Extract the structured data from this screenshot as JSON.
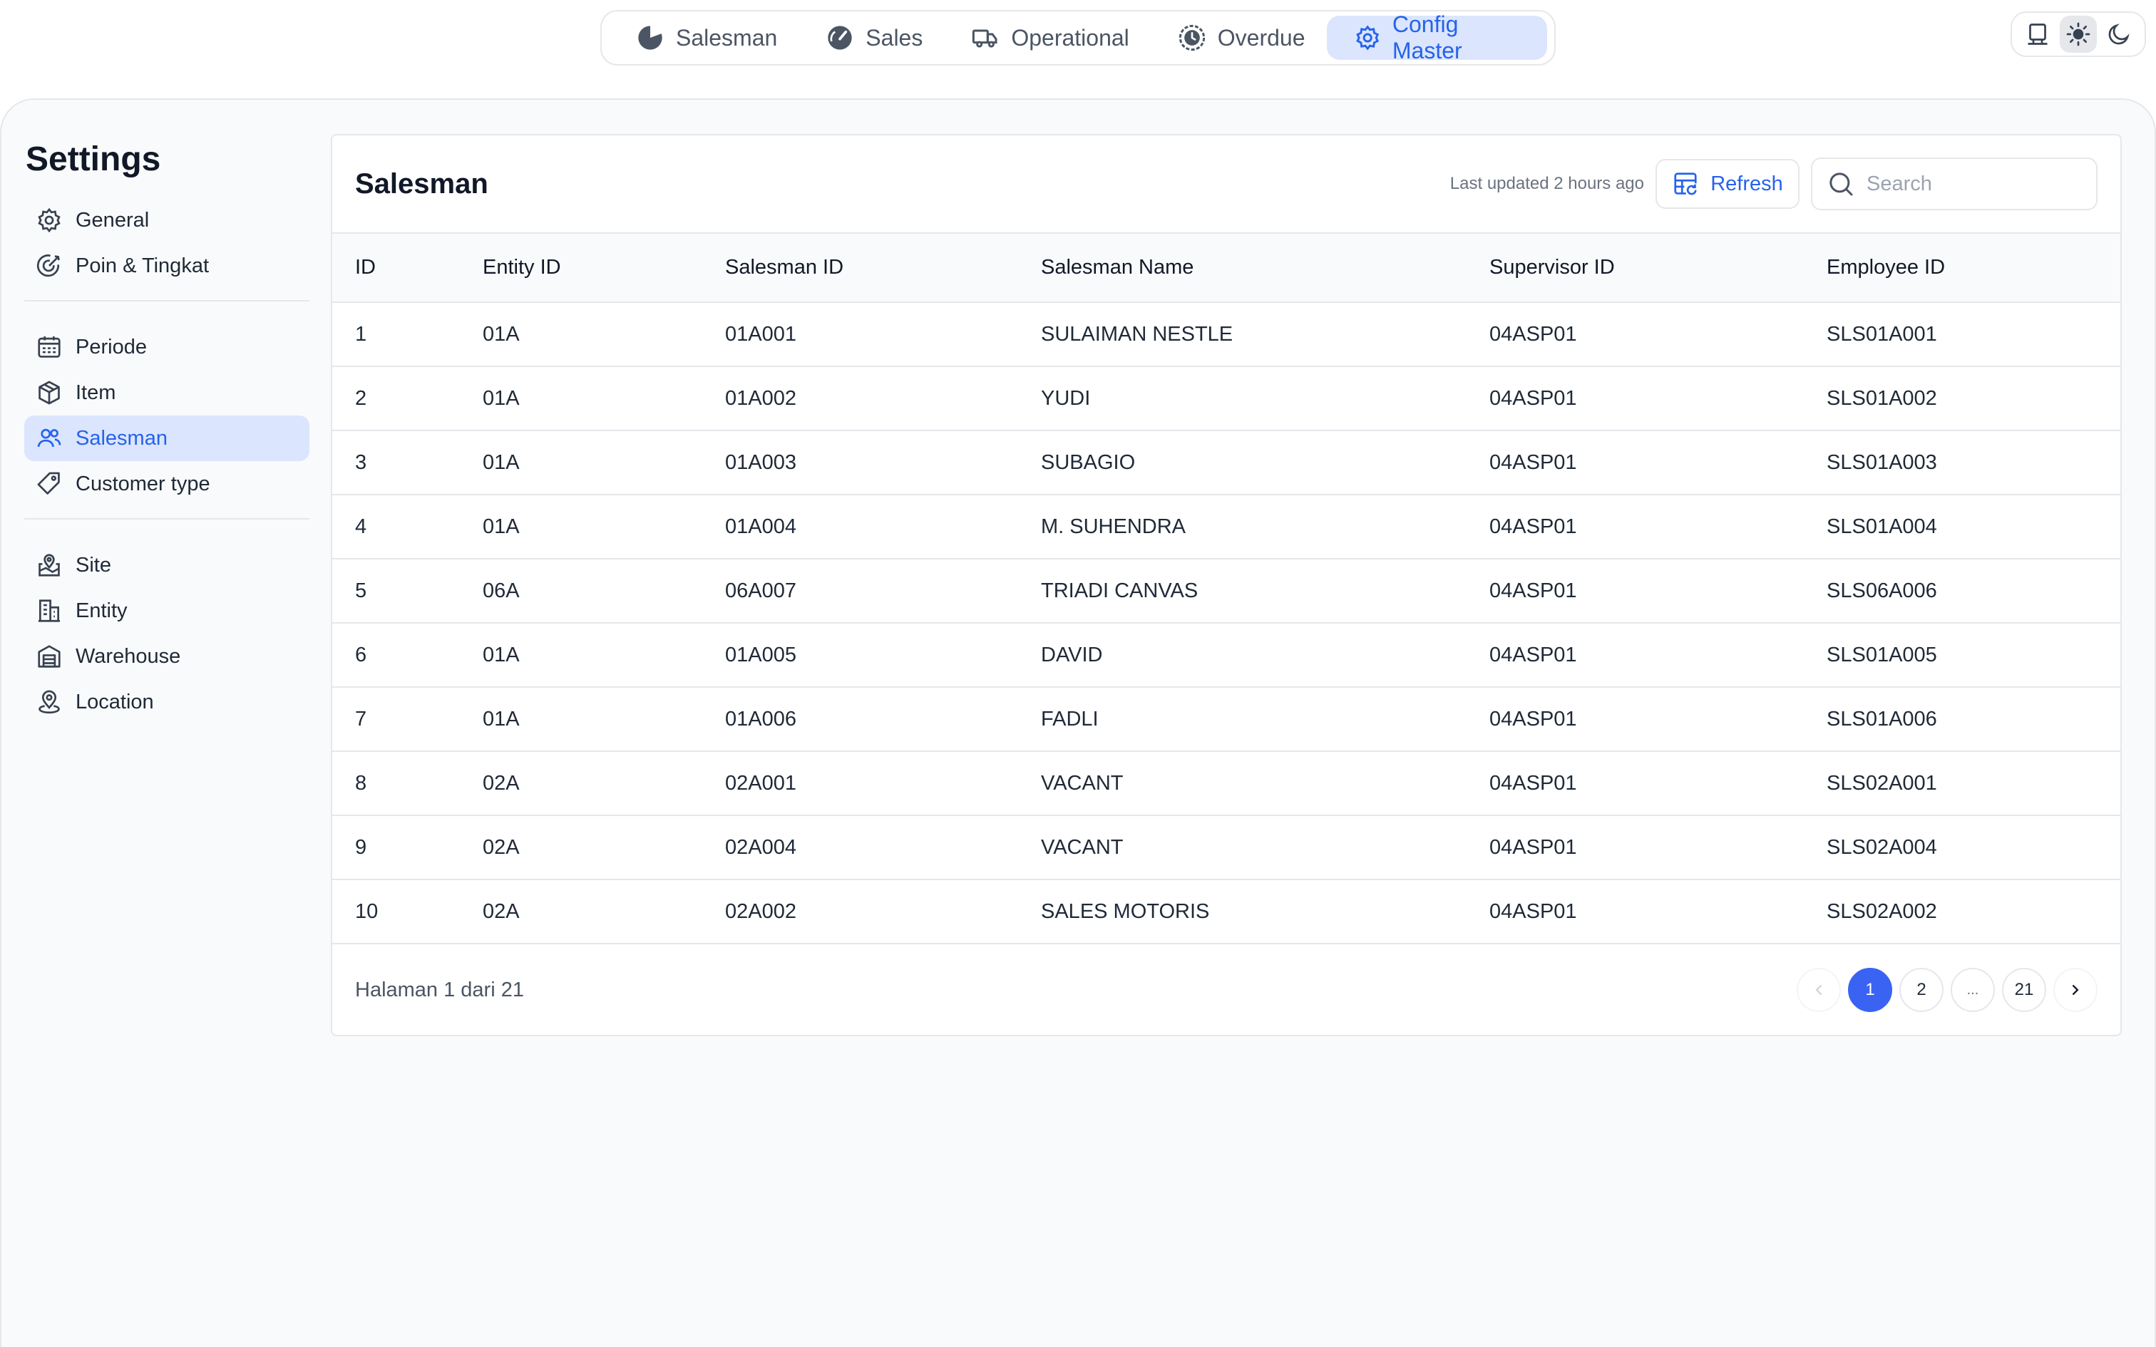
{
  "nav": {
    "tabs": [
      {
        "label": "Salesman",
        "icon": "pie-chart-icon"
      },
      {
        "label": "Sales",
        "icon": "gauge-icon"
      },
      {
        "label": "Operational",
        "icon": "truck-icon"
      },
      {
        "label": "Overdue",
        "icon": "clock-icon"
      },
      {
        "label": "Config Master",
        "icon": "cog-icon",
        "active": true
      }
    ]
  },
  "theme_switch": {
    "options": [
      "system-icon",
      "sun-icon",
      "moon-icon"
    ],
    "active": "sun-icon"
  },
  "sidebar": {
    "title": "Settings",
    "groups": [
      [
        {
          "label": "General",
          "icon": "gear-icon"
        },
        {
          "label": "Poin & Tingkat",
          "icon": "target-icon"
        }
      ],
      [
        {
          "label": "Periode",
          "icon": "calendar-icon"
        },
        {
          "label": "Item",
          "icon": "box-icon"
        },
        {
          "label": "Salesman",
          "icon": "users-icon",
          "active": true
        },
        {
          "label": "Customer type",
          "icon": "tag-icon"
        }
      ],
      [
        {
          "label": "Site",
          "icon": "map-pin-icon"
        },
        {
          "label": "Entity",
          "icon": "building-icon"
        },
        {
          "label": "Warehouse",
          "icon": "warehouse-icon"
        },
        {
          "label": "Location",
          "icon": "location-icon"
        }
      ]
    ]
  },
  "card": {
    "title": "Salesman",
    "last_updated": "Last updated 2 hours ago",
    "refresh_label": "Refresh",
    "search_placeholder": "Search",
    "search_value": ""
  },
  "table": {
    "columns": [
      "ID",
      "Entity ID",
      "Salesman ID",
      "Salesman Name",
      "Supervisor ID",
      "Employee ID"
    ],
    "rows": [
      [
        "1",
        "01A",
        "01A001",
        "SULAIMAN NESTLE",
        "04ASP01",
        "SLS01A001"
      ],
      [
        "2",
        "01A",
        "01A002",
        "YUDI",
        "04ASP01",
        "SLS01A002"
      ],
      [
        "3",
        "01A",
        "01A003",
        "SUBAGIO",
        "04ASP01",
        "SLS01A003"
      ],
      [
        "4",
        "01A",
        "01A004",
        "M. SUHENDRA",
        "04ASP01",
        "SLS01A004"
      ],
      [
        "5",
        "06A",
        "06A007",
        "TRIADI CANVAS",
        "04ASP01",
        "SLS06A006"
      ],
      [
        "6",
        "01A",
        "01A005",
        "DAVID",
        "04ASP01",
        "SLS01A005"
      ],
      [
        "7",
        "01A",
        "01A006",
        "FADLI",
        "04ASP01",
        "SLS01A006"
      ],
      [
        "8",
        "02A",
        "02A001",
        "VACANT",
        "04ASP01",
        "SLS02A001"
      ],
      [
        "9",
        "02A",
        "02A004",
        "VACANT",
        "04ASP01",
        "SLS02A004"
      ],
      [
        "10",
        "02A",
        "02A002",
        "SALES MOTORIS",
        "04ASP01",
        "SLS02A002"
      ]
    ]
  },
  "pagination": {
    "info": "Halaman 1 dari 21",
    "pages": [
      "1",
      "2",
      "...",
      "21"
    ],
    "current": "1"
  },
  "colors": {
    "accent": "#2563eb",
    "active_bg": "#dbe5fd",
    "page_current": "#3b63f3"
  }
}
